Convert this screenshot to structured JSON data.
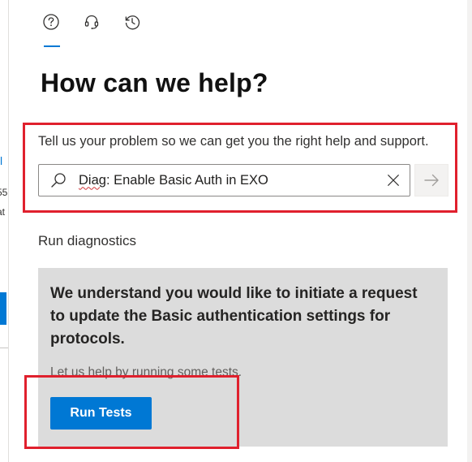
{
  "background_page": {
    "fragments": [
      "t",
      "l",
      "55",
      "at"
    ]
  },
  "tabs": [
    {
      "name": "help",
      "icon": "question-circle-icon",
      "active": true
    },
    {
      "name": "contact-support",
      "icon": "headset-icon",
      "active": false
    },
    {
      "name": "history",
      "icon": "history-icon",
      "active": false
    }
  ],
  "header": {
    "title": "How can we help?"
  },
  "search": {
    "prompt": "Tell us your problem so we can get you the right help and support.",
    "value_prefix": "Diag",
    "value_rest": ": Enable Basic Auth in EXO",
    "search_icon": "search-icon",
    "clear_icon": "close-icon",
    "submit_icon": "arrow-right-icon"
  },
  "diagnostics": {
    "section_title": "Run diagnostics",
    "message": "We understand you would like to initiate a request to update the Basic authentication settings for protocols.",
    "subtext": "Let us help by running some tests.",
    "button_label": "Run Tests"
  },
  "colors": {
    "accent": "#0078d4",
    "highlight": "#e0202d",
    "card_bg": "#dcdcdc"
  }
}
